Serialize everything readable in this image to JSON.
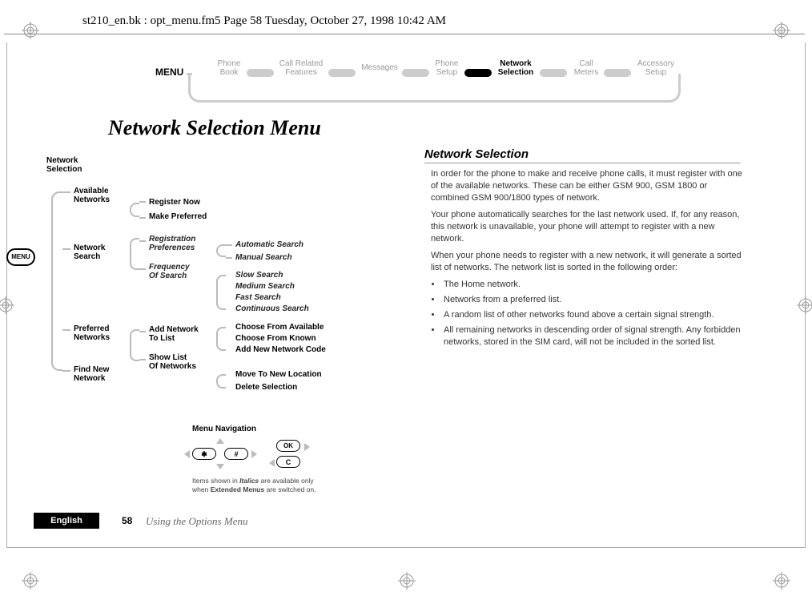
{
  "header_path": "st210_en.bk : opt_menu.fm5  Page 58  Tuesday, October 27, 1998  10:42 AM",
  "menubar": {
    "label": "MENU",
    "items": [
      {
        "line1": "Phone",
        "line2": "Book",
        "active": false
      },
      {
        "line1": "Call Related",
        "line2": "Features",
        "active": false
      },
      {
        "line1": "Messages",
        "line2": "",
        "active": false
      },
      {
        "line1": "Phone",
        "line2": "Setup",
        "active": false
      },
      {
        "line1": "Network",
        "line2": "Selection",
        "active": true
      },
      {
        "line1": "Call",
        "line2": "Meters",
        "active": false
      },
      {
        "line1": "Accessory",
        "line2": "Setup",
        "active": false
      }
    ]
  },
  "main_title": "Network Selection Menu",
  "menu_button": "MENU",
  "tree": {
    "root1": "Network",
    "root2": "Selection",
    "l1": [
      "Available",
      "Networks",
      "Network",
      "Search",
      "Preferred",
      "Networks",
      "Find New",
      "Network"
    ],
    "l2a": [
      "Register Now",
      "Make Preferred"
    ],
    "l2b": [
      "Registration",
      "Preferences",
      "Frequency",
      "Of Search"
    ],
    "l2c": [
      "Add Network",
      "To List",
      "Show List",
      "Of Networks"
    ],
    "l3a": [
      "Automatic Search",
      "Manual Search"
    ],
    "l3b": [
      "Slow Search",
      "Medium Search",
      "Fast Search",
      "Continuous Search"
    ],
    "l3c": [
      "Choose From Available",
      "Choose From Known",
      "Add New Network Code"
    ],
    "l3d": [
      "Move To New Location",
      "Delete Selection"
    ]
  },
  "text": {
    "heading": "Network Selection",
    "p1": "In order for the phone to make and receive phone calls, it must register with one of the available networks. These can be either GSM 900, GSM 1800 or combined GSM 900/1800 types of network.",
    "p2": "Your phone automatically searches for the last network used. If, for any reason, this network is unavailable, your phone will attempt to register with a new network.",
    "p3": "When your phone needs to register with a new network, it will generate a sorted list of networks. The network list is sorted in the following order:",
    "bullets": [
      "The Home network.",
      "Networks from a preferred list.",
      "A random list of other networks found above a certain signal strength.",
      "All remaining networks in descending order of signal strength. Any forbidden networks, stored in the SIM card, will not be included in the sorted list."
    ]
  },
  "navbox": {
    "title": "Menu Navigation",
    "star": "✱",
    "hash": "#",
    "ok": "OK",
    "c": "C",
    "note1": "Items shown in ",
    "note_italics": "Italics",
    "note2": " are available only",
    "note3": "when ",
    "note_ext": "Extended Menus",
    "note4": " are switched on."
  },
  "footer": {
    "lang": "English",
    "page": "58",
    "chapter": "Using the Options Menu"
  }
}
